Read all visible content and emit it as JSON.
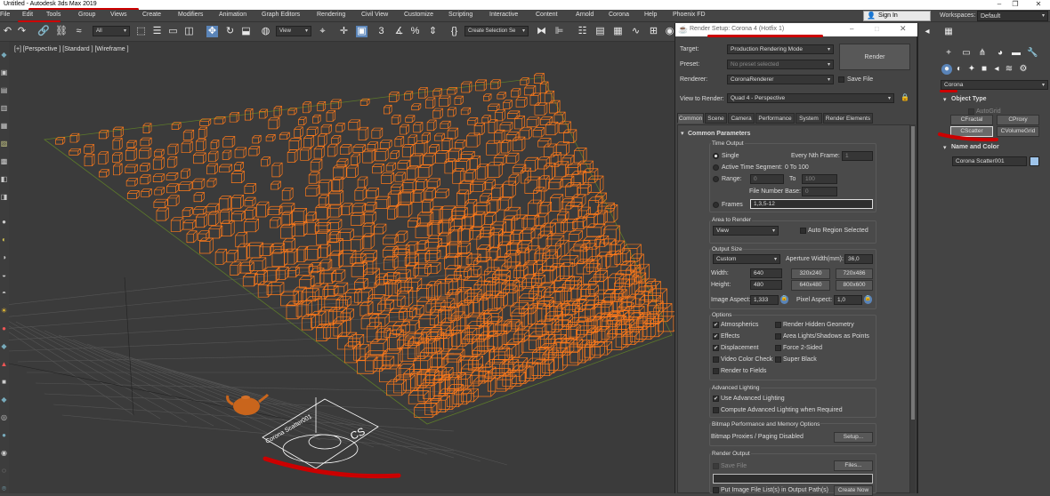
{
  "window": {
    "title": "Untitled - Autodesk 3ds Max 2019"
  },
  "menu": [
    "File",
    "Edit",
    "Tools",
    "Group",
    "Views",
    "Create",
    "Modifiers",
    "Animation",
    "Graph Editors",
    "Rendering",
    "Civil View",
    "Customize",
    "Scripting",
    "Interactive",
    "Content",
    "Arnold",
    "Corona",
    "Help",
    "Phoenix FD"
  ],
  "signin": "Sign In",
  "workspaces": {
    "label": "Workspaces:",
    "value": "Default"
  },
  "toolbar": {
    "filter": "All",
    "refcoord": "View",
    "selection_set": "Create Selection Se"
  },
  "viewport": {
    "label": "[+] [Perspective ] [Standard ] [Wireframe ]",
    "gizmo_text": "Corona Scatter001",
    "gizmo_logo": "CS"
  },
  "render_setup": {
    "title": "Render Setup: Corona 4 (Hotfix 1)",
    "target_label": "Target:",
    "target_value": "Production Rendering Mode",
    "preset_label": "Preset:",
    "preset_value": "No preset selected",
    "renderer_label": "Renderer:",
    "renderer_value": "CoronaRenderer",
    "save_file": "Save File",
    "render_button": "Render",
    "view_label": "View to Render:",
    "view_value": "Quad 4 - Perspective",
    "tabs": [
      "Common",
      "Scene",
      "Camera",
      "Performance",
      "System",
      "Render Elements"
    ],
    "rollout": "Common Parameters",
    "time_output": {
      "title": "Time Output",
      "single": "Single",
      "every_nth": "Every Nth Frame:",
      "every_nth_value": "1",
      "active_segment": "Active Time Segment:",
      "active_segment_value": "0 To 100",
      "range": "Range:",
      "range_from": "0",
      "to": "To",
      "range_to": "100",
      "file_number_base": "File Number Base:",
      "file_number_base_value": "0",
      "frames": "Frames",
      "frames_value": "1,3,5-12"
    },
    "area": {
      "title": "Area to Render",
      "value": "View",
      "auto_region": "Auto Region Selected"
    },
    "output_size": {
      "title": "Output Size",
      "preset": "Custom",
      "aperture_label": "Aperture Width(mm):",
      "aperture_value": "36,0",
      "width_label": "Width:",
      "width_value": "640",
      "height_label": "Height:",
      "height_value": "480",
      "presets": [
        "320x240",
        "720x486",
        "640x480",
        "800x600"
      ],
      "image_aspect_label": "Image Aspect:",
      "image_aspect_value": "1,333",
      "pixel_aspect_label": "Pixel Aspect:",
      "pixel_aspect_value": "1,0"
    },
    "options": {
      "title": "Options",
      "left": [
        {
          "label": "Atmospherics",
          "checked": "✔"
        },
        {
          "label": "Effects",
          "checked": "✔"
        },
        {
          "label": "Displacement",
          "checked": "✔"
        },
        {
          "label": "Video Color Check",
          "checked": ""
        },
        {
          "label": "Render to Fields",
          "checked": ""
        }
      ],
      "right": [
        {
          "label": "Render Hidden Geometry",
          "checked": ""
        },
        {
          "label": "Area Lights/Shadows as Points",
          "checked": ""
        },
        {
          "label": "Force 2-Sided",
          "checked": ""
        },
        {
          "label": "Super Black",
          "checked": ""
        }
      ]
    },
    "advanced_lighting": {
      "title": "Advanced Lighting",
      "use": "Use Advanced Lighting",
      "compute": "Compute Advanced Lighting when Required"
    },
    "bitmap": {
      "title": "Bitmap Performance and Memory Options",
      "status": "Bitmap Proxies / Paging Disabled",
      "setup": "Setup..."
    },
    "render_output": {
      "title": "Render Output",
      "save_file": "Save File",
      "files": "Files...",
      "put_image": "Put Image File List(s) in Output Path(s)",
      "create_now": "Create Now"
    }
  },
  "command_panel": {
    "category": "Corona",
    "object_type": "Object Type",
    "autogrid": "AutoGrid",
    "buttons": [
      "CFractal",
      "CProxy",
      "CScatter",
      "CVolumeGrid"
    ],
    "name_color": "Name and Color",
    "object_name": "Corona Scatter001",
    "object_color": "#9ec4ea"
  },
  "colors": {
    "wire": "#ff7a1a",
    "accent": "#5a84b8",
    "annotation": "#cc0000"
  }
}
